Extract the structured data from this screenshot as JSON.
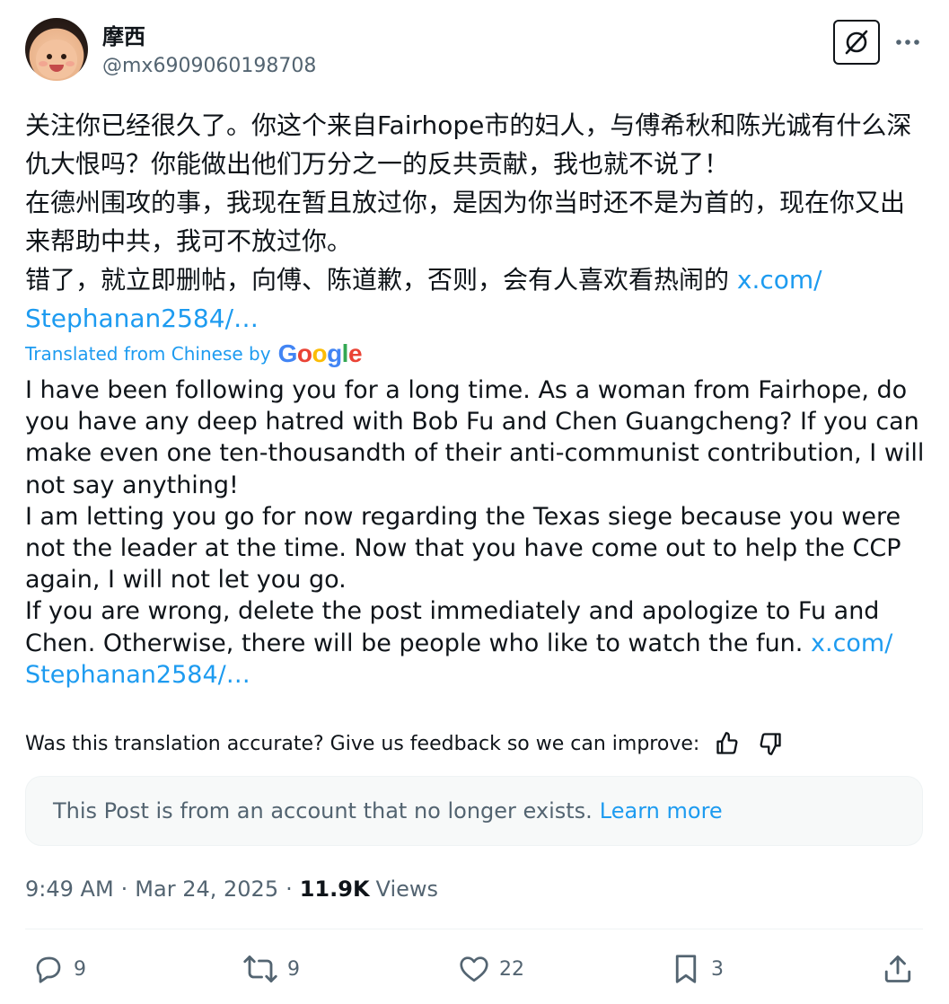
{
  "user": {
    "display_name": "摩西",
    "handle": "@mx6909060198708"
  },
  "post": {
    "original_text": "关注你已经很久了。你这个来自Fairhope市的妇人，与傅希秋和陈光诚有什么深仇大恨吗？你能做出他们万分之一的反共贡献，我也就不说了！\n在德州围攻的事，我现在暂且放过你，是因为你当时还不是为首的，现在你又出来帮助中共，我可不放过你。\n错了，就立即删帖，向傅、陈道歉，否则，会有人喜欢看热闹的 ",
    "original_link": "x.com/\nStephanan2584/…",
    "translated_label": "Translated from Chinese by",
    "google_logo": "Google",
    "translated_text": "I have been following you for a long time. As a woman from Fairhope, do you have any deep hatred with Bob Fu and Chen Guangcheng? If you can make even one ten-thousandth of their anti-communist contribution, I will not say anything!\nI am letting you go for now regarding the Texas siege because you were not the leader at the time. Now that you have come out to help the CCP again, I will not let you go.\nIf you are wrong, delete the post immediately and apologize to Fu and Chen. Otherwise, there will be people who like to watch the fun. ",
    "translated_link": "x.com/\nStephanan2584/…"
  },
  "feedback": {
    "question": "Was this translation accurate? Give us feedback so we can improve:"
  },
  "notice": {
    "text": "This Post is from an account that no longer exists.",
    "learn_more": "Learn more"
  },
  "meta": {
    "time": "9:49 AM",
    "date": "Mar 24, 2025",
    "separator": "·",
    "views_count": "11.9K",
    "views_label": "Views"
  },
  "actions": {
    "replies": "9",
    "reposts": "9",
    "likes": "22",
    "bookmarks": "3"
  },
  "colors": {
    "link": "#1d9bf0",
    "secondary_text": "#536471",
    "primary_text": "#0f1419",
    "google_blue": "#4285f4",
    "google_red": "#ea4335",
    "google_yellow": "#fbbc05",
    "google_green": "#34a853"
  },
  "icons": [
    "grok-icon",
    "more-icon",
    "thumbs-up-icon",
    "thumbs-down-icon",
    "reply-icon",
    "repost-icon",
    "like-icon",
    "bookmark-icon",
    "share-icon"
  ]
}
